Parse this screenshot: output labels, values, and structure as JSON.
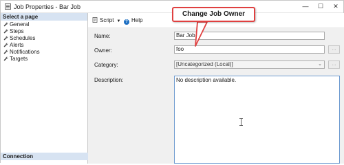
{
  "window": {
    "title": "Job Properties - Bar Job",
    "minimize_glyph": "—",
    "maximize_glyph": "☐",
    "close_glyph": "✕"
  },
  "left_pane": {
    "header": "Select a page",
    "items": [
      {
        "label": "General",
        "icon": "wrench-icon"
      },
      {
        "label": "Steps",
        "icon": "wrench-icon"
      },
      {
        "label": "Schedules",
        "icon": "wrench-icon"
      },
      {
        "label": "Alerts",
        "icon": "wrench-icon"
      },
      {
        "label": "Notifications",
        "icon": "wrench-icon"
      },
      {
        "label": "Targets",
        "icon": "wrench-icon"
      }
    ],
    "connection_header": "Connection"
  },
  "toolbar": {
    "script_label": "Script",
    "help_label": "Help",
    "caret_glyph": "▼",
    "help_glyph": "?"
  },
  "form": {
    "name_label": "Name:",
    "name_value": "Bar Job",
    "owner_label": "Owner:",
    "owner_value": "foo",
    "category_label": "Category:",
    "category_value": "[Uncategorized (Local)]",
    "description_label": "Description:",
    "description_value": "No description available.",
    "ellipsis_label": "...",
    "select_caret_glyph": "⌄"
  },
  "callout": {
    "text": "Change Job Owner",
    "border_color": "#e04040"
  },
  "colors": {
    "pane_header_bg": "#d7e3f2",
    "form_bg": "#f0f0f0",
    "help_icon": "#1b6ec2"
  }
}
